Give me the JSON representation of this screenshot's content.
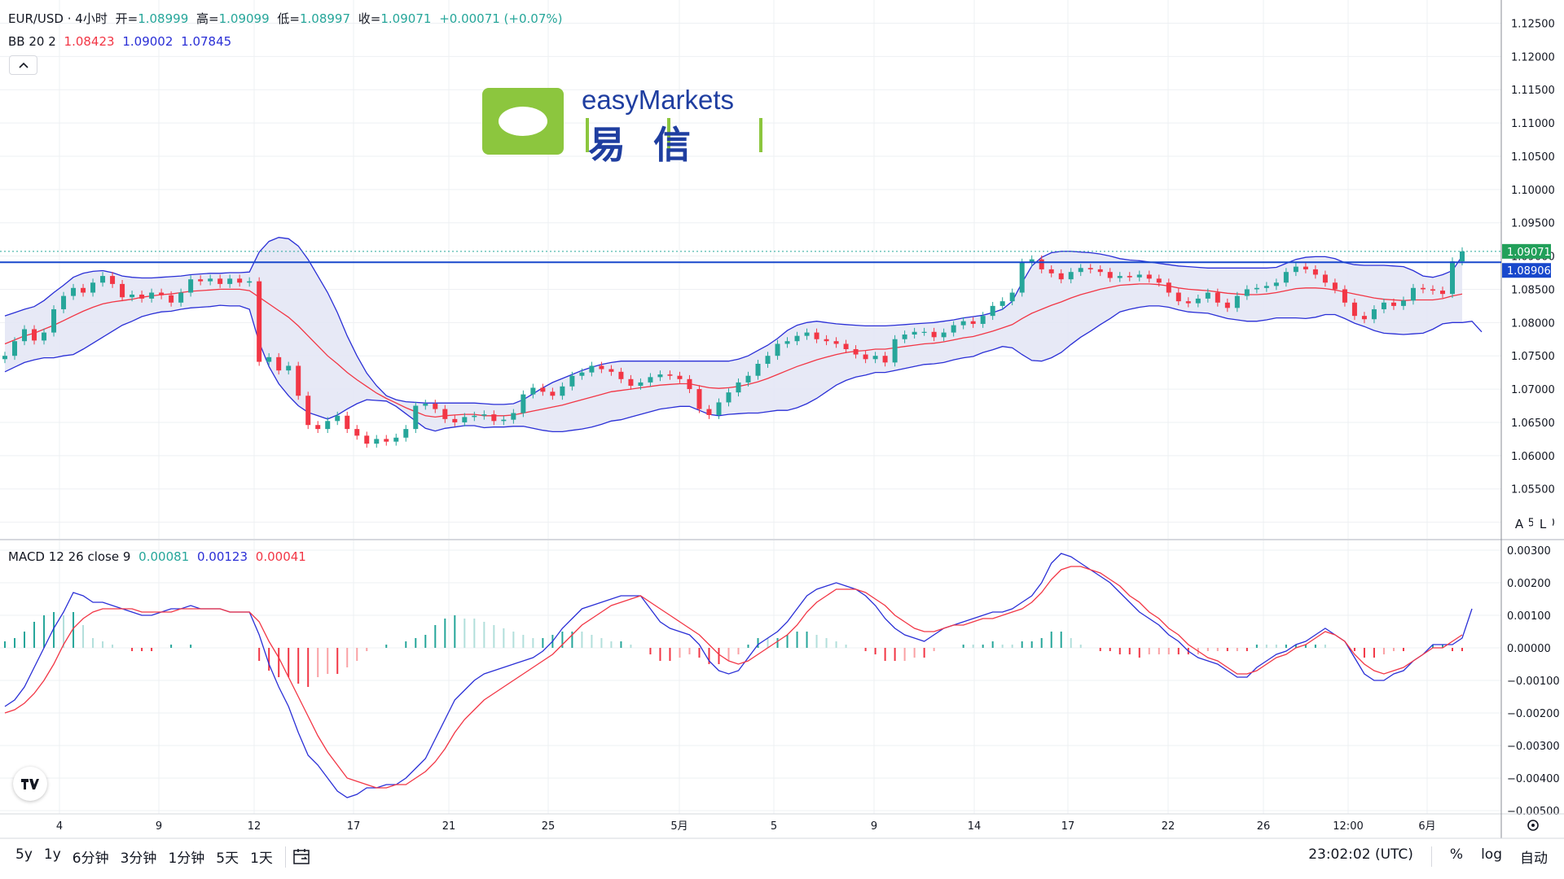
{
  "header": {
    "symbol": "EUR/USD · 4小时",
    "open_label": "开=",
    "open": "1.08999",
    "high_label": "高=",
    "high": "1.09099",
    "low_label": "低=",
    "low": "1.08997",
    "close_label": "收=",
    "close": "1.09071",
    "change": "+0.00071 (+0.07%)"
  },
  "bb_legend": {
    "name": "BB 20 2",
    "basis": "1.08423",
    "upper": "1.09002",
    "lower": "1.07845"
  },
  "macd_legend": {
    "name": "MACD 12 26 close 9",
    "hist": "0.00081",
    "macd": "0.00123",
    "signal": "0.00041"
  },
  "collapse_icon": "chevron-up-icon",
  "logo": {
    "text": "easyMarkets",
    "chinese": "易信"
  },
  "price_axis_labels": [
    "1.12500",
    "1.12000",
    "1.11500",
    "1.11000",
    "1.10500",
    "1.10000",
    "1.09500",
    "1.09000",
    "1.08500",
    "1.08000",
    "1.07500",
    "1.07000",
    "1.06500",
    "1.06000",
    "1.05500",
    "1.05000"
  ],
  "last_price_tag": "1.09071",
  "hline_tag": "1.08906",
  "scale_buttons": [
    "A",
    "L"
  ],
  "macd_axis_labels": [
    "0.00300",
    "0.00200",
    "0.00100",
    "0.00000",
    "−0.00100",
    "−0.00200",
    "−0.00300",
    "−0.00400",
    "−0.00500"
  ],
  "time_labels": [
    "4",
    "9",
    "12",
    "17",
    "21",
    "25",
    "5月",
    "5",
    "9",
    "14",
    "17",
    "22",
    "26",
    "12:00",
    "6月"
  ],
  "timeframes": [
    "5y",
    "1y",
    "6分钟",
    "3分钟",
    "1分钟",
    "5天",
    "1天"
  ],
  "compare_icon": "calendar-range-icon",
  "clock": "23:02:02 (UTC)",
  "bottom_options": [
    "%",
    "log",
    "自动"
  ],
  "settings_icon": "gear-icon",
  "colors": {
    "up": "#26a69a",
    "down": "#f23645",
    "bb": "#2a2fd6",
    "basis": "#f23645",
    "fill": "#e3e5f5",
    "macd": "#2a2fd6",
    "signal": "#f23645",
    "hline": "#1848cc"
  },
  "chart_data": {
    "type": "candlestick",
    "symbol": "EUR/USD",
    "interval": "4小时",
    "ylim": [
      1.0475,
      1.1275
    ],
    "macd_ylim": [
      -0.0051,
      0.0032
    ],
    "hline": 1.08906,
    "series": [
      {
        "name": "EUR/USD",
        "close": [
          1.075,
          1.0772,
          1.079,
          1.0773,
          1.0785,
          1.082,
          1.084,
          1.0852,
          1.0845,
          1.086,
          1.087,
          1.0858,
          1.0838,
          1.0842,
          1.0836,
          1.0845,
          1.0841,
          1.083,
          1.0845,
          1.0865,
          1.0862,
          1.0866,
          1.0858,
          1.0866,
          1.086,
          1.0862,
          1.0741,
          1.0748,
          1.0728,
          1.0735,
          1.069,
          1.0646,
          1.064,
          1.0652,
          1.066,
          1.064,
          1.063,
          1.0618,
          1.0625,
          1.0621,
          1.0627,
          1.064,
          1.0675,
          1.0678,
          1.067,
          1.0655,
          1.065,
          1.0658,
          1.066,
          1.0662,
          1.0652,
          1.0654,
          1.0664,
          1.0692,
          1.0702,
          1.0696,
          1.069,
          1.0704,
          1.072,
          1.0725,
          1.0735,
          1.073,
          1.0726,
          1.0715,
          1.0705,
          1.071,
          1.0718,
          1.0722,
          1.072,
          1.0715,
          1.07,
          1.067,
          1.0661,
          1.068,
          1.0695,
          1.071,
          1.072,
          1.0738,
          1.075,
          1.0768,
          1.0772,
          1.078,
          1.0785,
          1.0775,
          1.0772,
          1.0768,
          1.076,
          1.0752,
          1.0745,
          1.075,
          1.074,
          1.0775,
          1.0782,
          1.0786,
          1.0786,
          1.0778,
          1.0785,
          1.0796,
          1.0802,
          1.0798,
          1.081,
          1.0825,
          1.0832,
          1.0845,
          1.089,
          1.0895,
          1.088,
          1.0874,
          1.0865,
          1.0876,
          1.0882,
          1.088,
          1.0876,
          1.0867,
          1.087,
          1.0868,
          1.0872,
          1.0866,
          1.086,
          1.0845,
          1.0832,
          1.0829,
          1.0836,
          1.0845,
          1.083,
          1.0822,
          1.084,
          1.085,
          1.0852,
          1.0855,
          1.086,
          1.0876,
          1.0884,
          1.088,
          1.0872,
          1.086,
          1.085,
          1.083,
          1.081,
          1.0805,
          1.082,
          1.083,
          1.0825,
          1.0833,
          1.0852,
          1.085,
          1.0848,
          1.0843,
          1.0892,
          1.0907
        ]
      },
      {
        "name": "BB basis",
        "values": [
          1.0768,
          1.0774,
          1.078,
          1.0784,
          1.079,
          1.0796,
          1.0803,
          1.081,
          1.0817,
          1.0823,
          1.0828,
          1.0831,
          1.0833,
          1.0835,
          1.0838,
          1.084,
          1.0842,
          1.0843,
          1.0845,
          1.0847,
          1.0848,
          1.0849,
          1.085,
          1.085,
          1.085,
          1.0848,
          1.0838,
          1.0828,
          1.0818,
          1.0808,
          1.0795,
          1.078,
          1.0765,
          1.075,
          1.0738,
          1.0725,
          1.0714,
          1.0704,
          1.0694,
          1.0686,
          1.0679,
          1.0672,
          1.0666,
          1.066,
          1.0658,
          1.066,
          1.0661,
          1.0662,
          1.0662,
          1.066,
          1.066,
          1.066,
          1.0661,
          1.0664,
          1.0667,
          1.067,
          1.0673,
          1.0676,
          1.068,
          1.0684,
          1.0688,
          1.0692,
          1.0696,
          1.0698,
          1.07,
          1.0702,
          1.0704,
          1.0706,
          1.0707,
          1.0708,
          1.0708,
          1.0705,
          1.0702,
          1.0701,
          1.0702,
          1.0704,
          1.0707,
          1.0711,
          1.0716,
          1.0722,
          1.0728,
          1.0734,
          1.0739,
          1.0744,
          1.0748,
          1.0752,
          1.0755,
          1.0757,
          1.0758,
          1.076,
          1.076,
          1.0762,
          1.0764,
          1.0766,
          1.0768,
          1.0769,
          1.0771,
          1.0774,
          1.0777,
          1.0779,
          1.0783,
          1.0787,
          1.0792,
          1.0797,
          1.0806,
          1.0814,
          1.082,
          1.0826,
          1.0831,
          1.0837,
          1.0842,
          1.0846,
          1.085,
          1.0853,
          1.0856,
          1.0857,
          1.0858,
          1.0858,
          1.0857,
          1.0855,
          1.0852,
          1.085,
          1.0849,
          1.0848,
          1.0846,
          1.0844,
          1.0843,
          1.0842,
          1.0842,
          1.0843,
          1.0845,
          1.0848,
          1.0851,
          1.0852,
          1.0852,
          1.0851,
          1.0849,
          1.0846,
          1.0843,
          1.084,
          1.0837,
          1.0835,
          1.0834,
          1.0833,
          1.0834,
          1.0834,
          1.0834,
          1.0836,
          1.084,
          1.0843
        ]
      },
      {
        "name": "BB upper",
        "values": [
          1.081,
          1.0815,
          1.082,
          1.0824,
          1.0833,
          1.0845,
          1.0856,
          1.0868,
          1.0874,
          1.0877,
          1.0878,
          1.0875,
          1.087,
          1.0868,
          1.0867,
          1.0867,
          1.0868,
          1.0869,
          1.087,
          1.0872,
          1.0873,
          1.0874,
          1.0874,
          1.0875,
          1.0875,
          1.0876,
          1.0906,
          1.0922,
          1.0928,
          1.0926,
          1.0915,
          1.0895,
          1.087,
          1.0845,
          1.0815,
          1.078,
          1.075,
          1.0724,
          1.0705,
          1.069,
          1.0684,
          1.0681,
          1.068,
          1.0679,
          1.0679,
          1.0679,
          1.0679,
          1.0679,
          1.0679,
          1.0678,
          1.0677,
          1.0677,
          1.0678,
          1.0684,
          1.0693,
          1.0702,
          1.071,
          1.0716,
          1.0722,
          1.0728,
          1.0733,
          1.0737,
          1.074,
          1.0742,
          1.0742,
          1.0742,
          1.0742,
          1.0742,
          1.0742,
          1.0742,
          1.0742,
          1.0742,
          1.0742,
          1.0742,
          1.0742,
          1.0745,
          1.075,
          1.0758,
          1.0766,
          1.0776,
          1.0788,
          1.0796,
          1.08,
          1.0802,
          1.08,
          1.0798,
          1.0797,
          1.0796,
          1.0795,
          1.0795,
          1.0795,
          1.0796,
          1.0797,
          1.0798,
          1.0799,
          1.08,
          1.0802,
          1.0804,
          1.0807,
          1.0809,
          1.0811,
          1.0815,
          1.082,
          1.0832,
          1.086,
          1.0885,
          1.0898,
          1.0905,
          1.0907,
          1.0907,
          1.0906,
          1.0905,
          1.0903,
          1.09,
          1.0896,
          1.0894,
          1.0893,
          1.0891,
          1.0889,
          1.0887,
          1.0885,
          1.0884,
          1.0883,
          1.0882,
          1.0882,
          1.0882,
          1.0882,
          1.0882,
          1.0882,
          1.0882,
          1.0883,
          1.0889,
          1.0895,
          1.0898,
          1.0899,
          1.0899,
          1.0896,
          1.089,
          1.0887,
          1.0886,
          1.0886,
          1.0886,
          1.0885,
          1.0884,
          1.0878,
          1.087,
          1.0868,
          1.0872,
          1.0878,
          1.09
        ]
      },
      {
        "name": "BB lower",
        "values": [
          1.0726,
          1.0733,
          1.074,
          1.0744,
          1.0747,
          1.0747,
          1.075,
          1.0752,
          1.076,
          1.0769,
          1.0778,
          1.0787,
          1.0796,
          1.0802,
          1.0809,
          1.0813,
          1.0816,
          1.0817,
          1.082,
          1.0822,
          1.0823,
          1.0824,
          1.0826,
          1.0825,
          1.0825,
          1.082,
          1.077,
          1.0734,
          1.0708,
          1.069,
          1.0675,
          1.0665,
          1.066,
          1.0655,
          1.0661,
          1.067,
          1.0678,
          1.0684,
          1.0683,
          1.0682,
          1.0674,
          1.0663,
          1.0652,
          1.0641,
          1.0637,
          1.0641,
          1.0643,
          1.0645,
          1.0645,
          1.0642,
          1.0643,
          1.0643,
          1.0644,
          1.0644,
          1.0641,
          1.0638,
          1.0636,
          1.0636,
          1.0638,
          1.064,
          1.0643,
          1.0647,
          1.0652,
          1.0654,
          1.0658,
          1.0662,
          1.0666,
          1.067,
          1.0672,
          1.0674,
          1.0674,
          1.0668,
          1.0662,
          1.066,
          1.0662,
          1.0663,
          1.0664,
          1.0664,
          1.0666,
          1.0668,
          1.0668,
          1.0672,
          1.0678,
          1.0686,
          1.0696,
          1.0706,
          1.0713,
          1.0718,
          1.0721,
          1.0725,
          1.0725,
          1.0728,
          1.0731,
          1.0734,
          1.0737,
          1.0738,
          1.074,
          1.0744,
          1.0747,
          1.0749,
          1.0755,
          1.0759,
          1.0764,
          1.0762,
          1.0752,
          1.0743,
          1.0742,
          1.0747,
          1.0755,
          1.0767,
          1.0778,
          1.0787,
          1.0797,
          1.0806,
          1.0816,
          1.082,
          1.0823,
          1.0825,
          1.0825,
          1.0823,
          1.0819,
          1.0816,
          1.0815,
          1.0814,
          1.081,
          1.0806,
          1.0804,
          1.0802,
          1.0802,
          1.0804,
          1.0807,
          1.0807,
          1.0807,
          1.0806,
          1.0808,
          1.0812,
          1.0812,
          1.0806,
          1.0799,
          1.0794,
          1.0788,
          1.0784,
          1.0783,
          1.0782,
          1.0783,
          1.0784,
          1.079,
          1.0798,
          1.08,
          1.08,
          1.0802,
          1.0786
        ]
      },
      {
        "name": "MACD",
        "values": [
          -0.0018,
          -0.0016,
          -0.0012,
          -0.0006,
          0.0,
          0.0006,
          0.0011,
          0.0017,
          0.0016,
          0.0014,
          0.0014,
          0.0013,
          0.0012,
          0.0011,
          0.001,
          0.001,
          0.0011,
          0.0012,
          0.0012,
          0.0013,
          0.0012,
          0.0012,
          0.0012,
          0.0011,
          0.0011,
          0.0011,
          0.0004,
          -0.0005,
          -0.0012,
          -0.0018,
          -0.0026,
          -0.0033,
          -0.0036,
          -0.004,
          -0.0044,
          -0.0046,
          -0.0045,
          -0.0043,
          -0.0043,
          -0.0042,
          -0.0042,
          -0.004,
          -0.0037,
          -0.0034,
          -0.0028,
          -0.0022,
          -0.0016,
          -0.0013,
          -0.001,
          -0.0008,
          -0.0007,
          -0.0006,
          -0.0005,
          -0.0004,
          -0.0003,
          -0.0001,
          0.0002,
          0.0006,
          0.0009,
          0.0012,
          0.0013,
          0.0014,
          0.0015,
          0.0016,
          0.0016,
          0.0016,
          0.0012,
          0.0008,
          0.0006,
          0.0005,
          0.0004,
          0.0001,
          -0.0004,
          -0.0007,
          -0.0008,
          -0.0007,
          -0.0003,
          0.0001,
          0.0003,
          0.0005,
          0.0008,
          0.0012,
          0.0016,
          0.0018,
          0.0019,
          0.002,
          0.0019,
          0.0018,
          0.0016,
          0.0013,
          0.0009,
          0.0006,
          0.0004,
          0.0003,
          0.0002,
          0.0004,
          0.0006,
          0.0007,
          0.0008,
          0.0009,
          0.001,
          0.0011,
          0.0011,
          0.0012,
          0.0014,
          0.0016,
          0.002,
          0.0026,
          0.0029,
          0.0028,
          0.0026,
          0.0024,
          0.0022,
          0.002,
          0.0017,
          0.0014,
          0.0011,
          0.0009,
          0.0007,
          0.0004,
          0.0002,
          -0.0001,
          -0.0003,
          -0.0004,
          -0.0005,
          -0.0007,
          -0.0009,
          -0.0009,
          -0.0006,
          -0.0004,
          -0.0002,
          -0.0001,
          0.0001,
          0.0002,
          0.0004,
          0.0006,
          0.0004,
          0.0002,
          -0.0003,
          -0.0008,
          -0.001,
          -0.001,
          -0.0008,
          -0.0007,
          -0.0004,
          -0.0002,
          0.0001,
          0.0001,
          0.0001,
          0.0003,
          0.0012
        ]
      },
      {
        "name": "Signal",
        "values": [
          -0.002,
          -0.0019,
          -0.0017,
          -0.0014,
          -0.001,
          -0.0005,
          0.0001,
          0.0006,
          0.0009,
          0.0011,
          0.0012,
          0.0012,
          0.0012,
          0.0012,
          0.0011,
          0.0011,
          0.0011,
          0.0011,
          0.0012,
          0.0012,
          0.0012,
          0.0012,
          0.0012,
          0.0011,
          0.0011,
          0.0011,
          0.0008,
          0.0002,
          -0.0003,
          -0.0009,
          -0.0015,
          -0.0021,
          -0.0027,
          -0.0032,
          -0.0036,
          -0.004,
          -0.0041,
          -0.0042,
          -0.0043,
          -0.0043,
          -0.0042,
          -0.0042,
          -0.004,
          -0.0038,
          -0.0035,
          -0.0031,
          -0.0026,
          -0.0022,
          -0.0019,
          -0.0016,
          -0.0014,
          -0.0012,
          -0.001,
          -0.0008,
          -0.0006,
          -0.0004,
          -0.0002,
          0.0001,
          0.0004,
          0.0007,
          0.0009,
          0.0011,
          0.0013,
          0.0014,
          0.0015,
          0.0016,
          0.0014,
          0.0012,
          0.001,
          0.0008,
          0.0006,
          0.0004,
          0.0001,
          -0.0002,
          -0.0004,
          -0.0005,
          -0.0004,
          -0.0002,
          0.0,
          0.0002,
          0.0004,
          0.0007,
          0.0011,
          0.0014,
          0.0016,
          0.0018,
          0.0018,
          0.0018,
          0.0017,
          0.0015,
          0.0013,
          0.001,
          0.0008,
          0.0006,
          0.0005,
          0.0005,
          0.0006,
          0.0007,
          0.0007,
          0.0008,
          0.0009,
          0.0009,
          0.001,
          0.0011,
          0.0012,
          0.0014,
          0.0017,
          0.0021,
          0.0024,
          0.0025,
          0.0025,
          0.0024,
          0.0023,
          0.0021,
          0.0019,
          0.0016,
          0.0014,
          0.0011,
          0.0009,
          0.0006,
          0.0004,
          0.0001,
          -0.0001,
          -0.0003,
          -0.0004,
          -0.0006,
          -0.0008,
          -0.0008,
          -0.0007,
          -0.0005,
          -0.0003,
          -0.0002,
          0.0,
          0.0001,
          0.0003,
          0.0005,
          0.0004,
          0.0002,
          -0.0002,
          -0.0005,
          -0.0007,
          -0.0008,
          -0.0007,
          -0.0006,
          -0.0004,
          -0.0002,
          0.0,
          0.0,
          0.0002,
          0.0004
        ]
      }
    ]
  }
}
